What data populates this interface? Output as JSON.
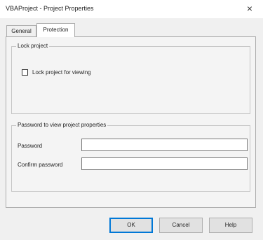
{
  "window": {
    "title": "VBAProject - Project Properties",
    "close_glyph": "×"
  },
  "tabs": [
    {
      "label": "General",
      "active": false
    },
    {
      "label": "Protection",
      "active": true
    }
  ],
  "lock_group": {
    "legend": "Lock project",
    "checkbox_label": "Lock project for viewing",
    "checked": false
  },
  "password_group": {
    "legend": "Password to view project properties",
    "password_label": "Password",
    "password_value": "",
    "confirm_label": "Confirm password",
    "confirm_value": ""
  },
  "buttons": {
    "ok": "OK",
    "cancel": "Cancel",
    "help": "Help"
  },
  "colors": {
    "default_button_border": "#0078d7",
    "dialog_bg": "#f0f0f0"
  }
}
